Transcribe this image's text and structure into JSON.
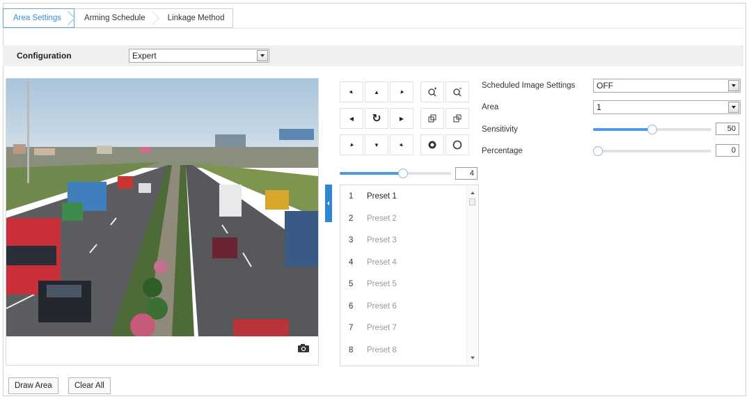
{
  "tabs": [
    {
      "label": "Area Settings",
      "active": true
    },
    {
      "label": "Arming Schedule",
      "active": false
    },
    {
      "label": "Linkage Method",
      "active": false
    }
  ],
  "configuration": {
    "label": "Configuration",
    "value": "Expert"
  },
  "ptz": {
    "buttons": [
      {
        "name": "ptz-up-left-icon",
        "glyph": "▲"
      },
      {
        "name": "ptz-up-icon",
        "glyph": "▲"
      },
      {
        "name": "ptz-up-right-icon",
        "glyph": "▲"
      },
      {
        "name": "zoom-in-icon",
        "glyph": ""
      },
      {
        "name": "zoom-out-icon",
        "glyph": ""
      },
      {
        "name": "ptz-left-icon",
        "glyph": "◀"
      },
      {
        "name": "auto-pan-icon",
        "glyph": "↻"
      },
      {
        "name": "ptz-right-icon",
        "glyph": "▶"
      },
      {
        "name": "focus-near-icon",
        "glyph": ""
      },
      {
        "name": "focus-far-icon",
        "glyph": ""
      },
      {
        "name": "ptz-down-left-icon",
        "glyph": "▼"
      },
      {
        "name": "ptz-down-icon",
        "glyph": "▼"
      },
      {
        "name": "ptz-down-right-icon",
        "glyph": "▼"
      },
      {
        "name": "iris-open-icon",
        "glyph": ""
      },
      {
        "name": "iris-close-icon",
        "glyph": ""
      }
    ],
    "speed": {
      "value": "4",
      "fraction": 0.57
    }
  },
  "presets": [
    {
      "num": "1",
      "name": "Preset 1"
    },
    {
      "num": "2",
      "name": "Preset 2"
    },
    {
      "num": "3",
      "name": "Preset 3"
    },
    {
      "num": "4",
      "name": "Preset 4"
    },
    {
      "num": "5",
      "name": "Preset 5"
    },
    {
      "num": "6",
      "name": "Preset 6"
    },
    {
      "num": "7",
      "name": "Preset 7"
    },
    {
      "num": "8",
      "name": "Preset 8"
    }
  ],
  "settings": {
    "scheduled_image": {
      "label": "Scheduled Image Settings",
      "value": "OFF"
    },
    "area": {
      "label": "Area",
      "value": "1"
    },
    "sensitivity": {
      "label": "Sensitivity",
      "value": "50",
      "fraction": 0.5
    },
    "percentage": {
      "label": "Percentage",
      "value": "0",
      "fraction": 0
    }
  },
  "buttons": {
    "draw_area": "Draw Area",
    "clear_all": "Clear All"
  },
  "colors": {
    "accent": "#3a8bd6",
    "slider_fill": "#4d9ae0",
    "handle": "#2f87d4"
  }
}
